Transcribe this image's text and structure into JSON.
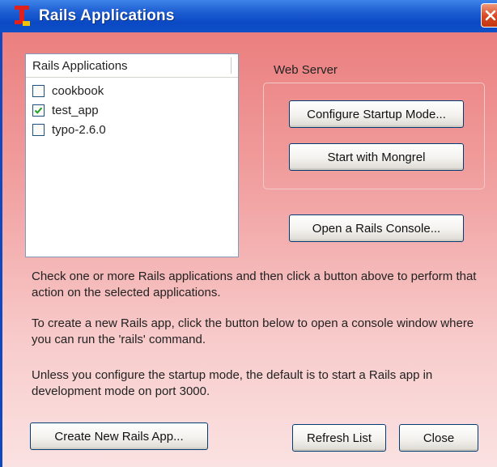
{
  "window": {
    "title": "Rails Applications"
  },
  "apps_list": {
    "header": "Rails Applications",
    "items": [
      {
        "label": "cookbook",
        "checked": false
      },
      {
        "label": "test_app",
        "checked": true
      },
      {
        "label": "typo-2.6.0",
        "checked": false
      }
    ]
  },
  "web_server": {
    "label": "Web Server",
    "configure_label": "Configure Startup Mode...",
    "start_label": "Start with Mongrel"
  },
  "console_label": "Open a Rails Console...",
  "help_text": [
    "Check one or more Rails applications and then click a button above to perform that action on the selected applications.",
    "To create a new Rails app, click the button below to open a console window where you can run the 'rails' command.",
    "Unless you configure the startup mode, the default is to start a Rails app in development mode on port 3000."
  ],
  "footer": {
    "create_label": "Create New Rails App...",
    "refresh_label": "Refresh List",
    "close_label": "Close"
  },
  "colors": {
    "titlebar": "#0a49c4",
    "background_top": "#eb7f7f",
    "background_bottom": "#fbe2e2",
    "accent_icon": "#e0201c"
  }
}
